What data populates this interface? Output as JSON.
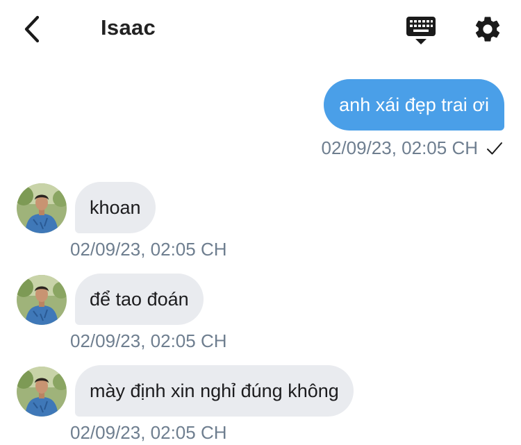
{
  "header": {
    "contact_name": "Isaac",
    "back_icon": "chevron-left-icon",
    "keyboard_icon": "keyboard-icon",
    "settings_icon": "gear-icon"
  },
  "messages": [
    {
      "direction": "outgoing",
      "text": "anh xái đẹp trai ơi",
      "time": "02/09/23, 02:05 CH",
      "status_icon": "check-icon"
    },
    {
      "direction": "incoming",
      "text": "khoan",
      "time": "02/09/23, 02:05 CH"
    },
    {
      "direction": "incoming",
      "text": "để tao đoán",
      "time": "02/09/23, 02:05 CH"
    },
    {
      "direction": "incoming",
      "text": "mày định xin nghỉ đúng không",
      "time": "02/09/23, 02:05 CH"
    }
  ],
  "colors": {
    "outgoing_bubble": "#4a9fe8",
    "incoming_bubble": "#e9ebef",
    "timestamp": "#6e7e8f"
  }
}
